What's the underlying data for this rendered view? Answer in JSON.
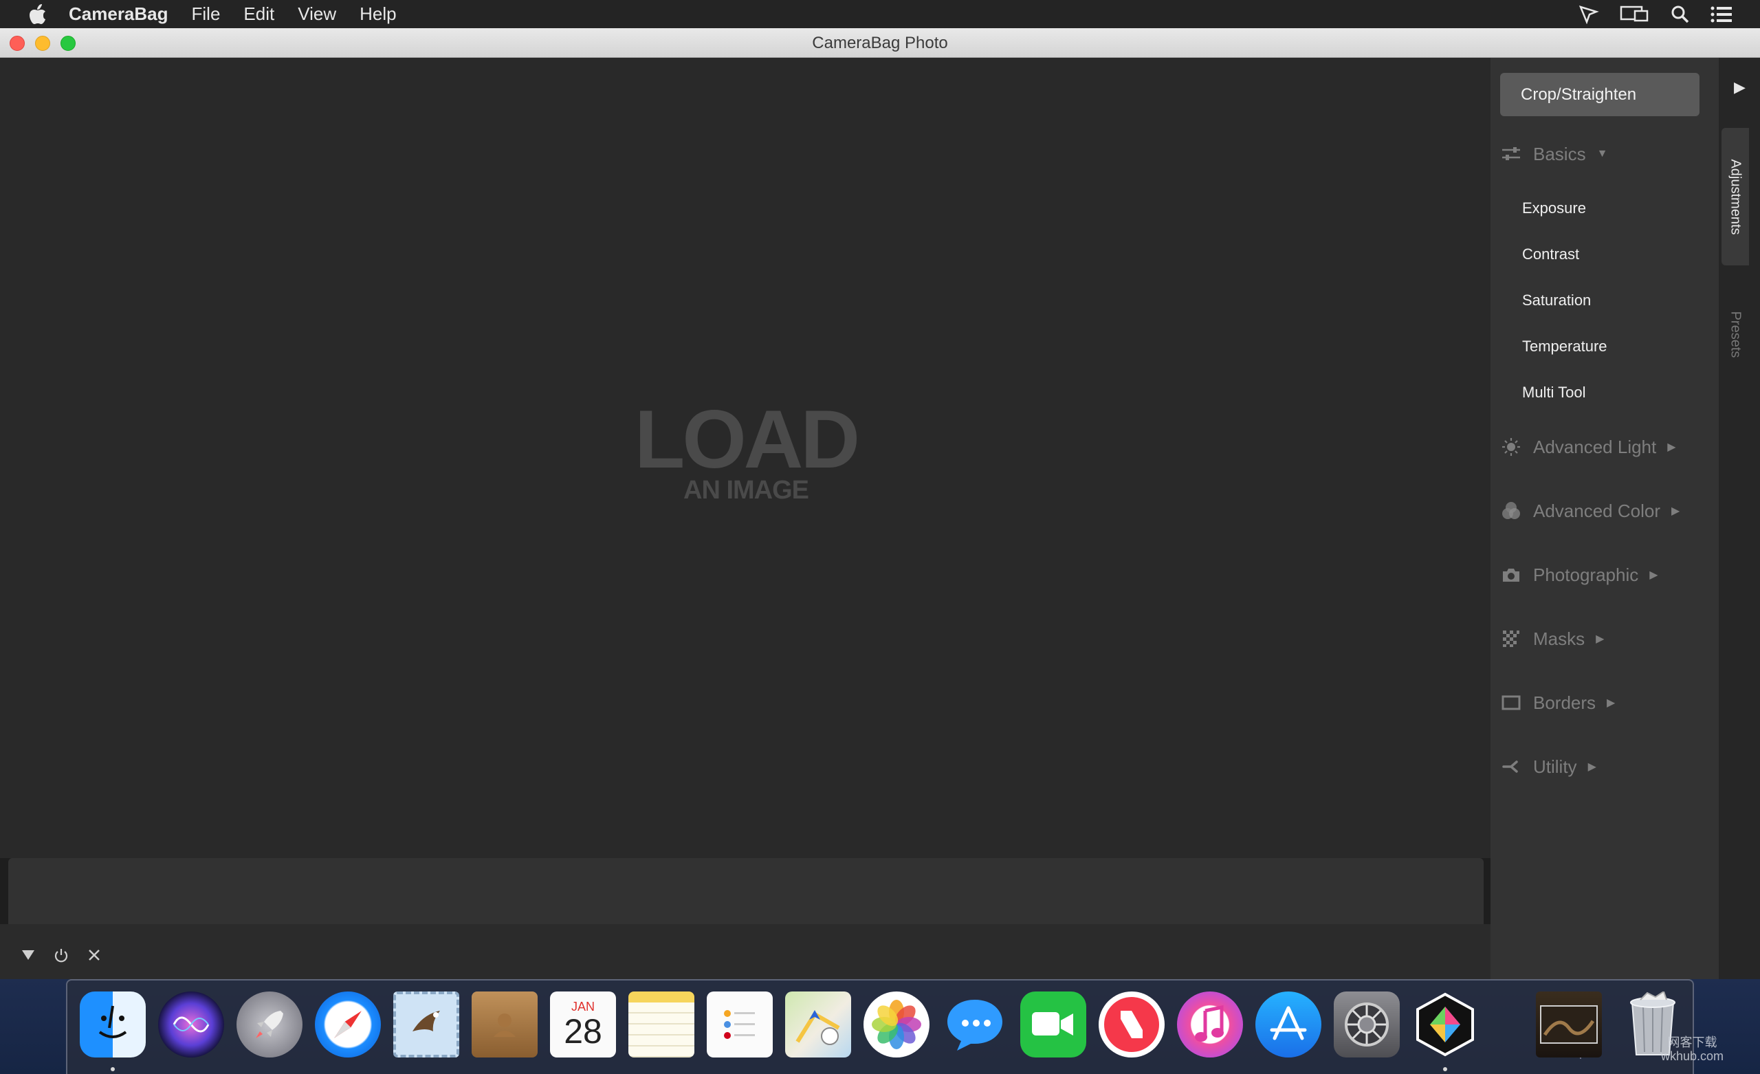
{
  "menubar": {
    "app": "CameraBag",
    "items": [
      "File",
      "Edit",
      "View",
      "Help"
    ]
  },
  "window": {
    "title": "CameraBag Photo"
  },
  "canvas": {
    "load_big": "LOAD",
    "load_small": "AN IMAGE"
  },
  "panel": {
    "crop_button": "Crop/Straighten",
    "basics": {
      "label": "Basics",
      "items": [
        "Exposure",
        "Contrast",
        "Saturation",
        "Temperature",
        "Multi Tool"
      ]
    },
    "sections": [
      "Advanced Light",
      "Advanced Color",
      "Photographic",
      "Masks",
      "Borders",
      "Utility"
    ]
  },
  "sidetabs": {
    "adjustments": "Adjustments",
    "presets": "Presets"
  },
  "dock": {
    "calendar_month": "JAN",
    "calendar_day": "28",
    "watermark_line1": "网客下载",
    "watermark_line2": "wkhub.com"
  },
  "colors": {
    "canvas": "#292929",
    "panel": "#333333",
    "crop_button": "#5a5a5a",
    "menubar": "#242424"
  }
}
